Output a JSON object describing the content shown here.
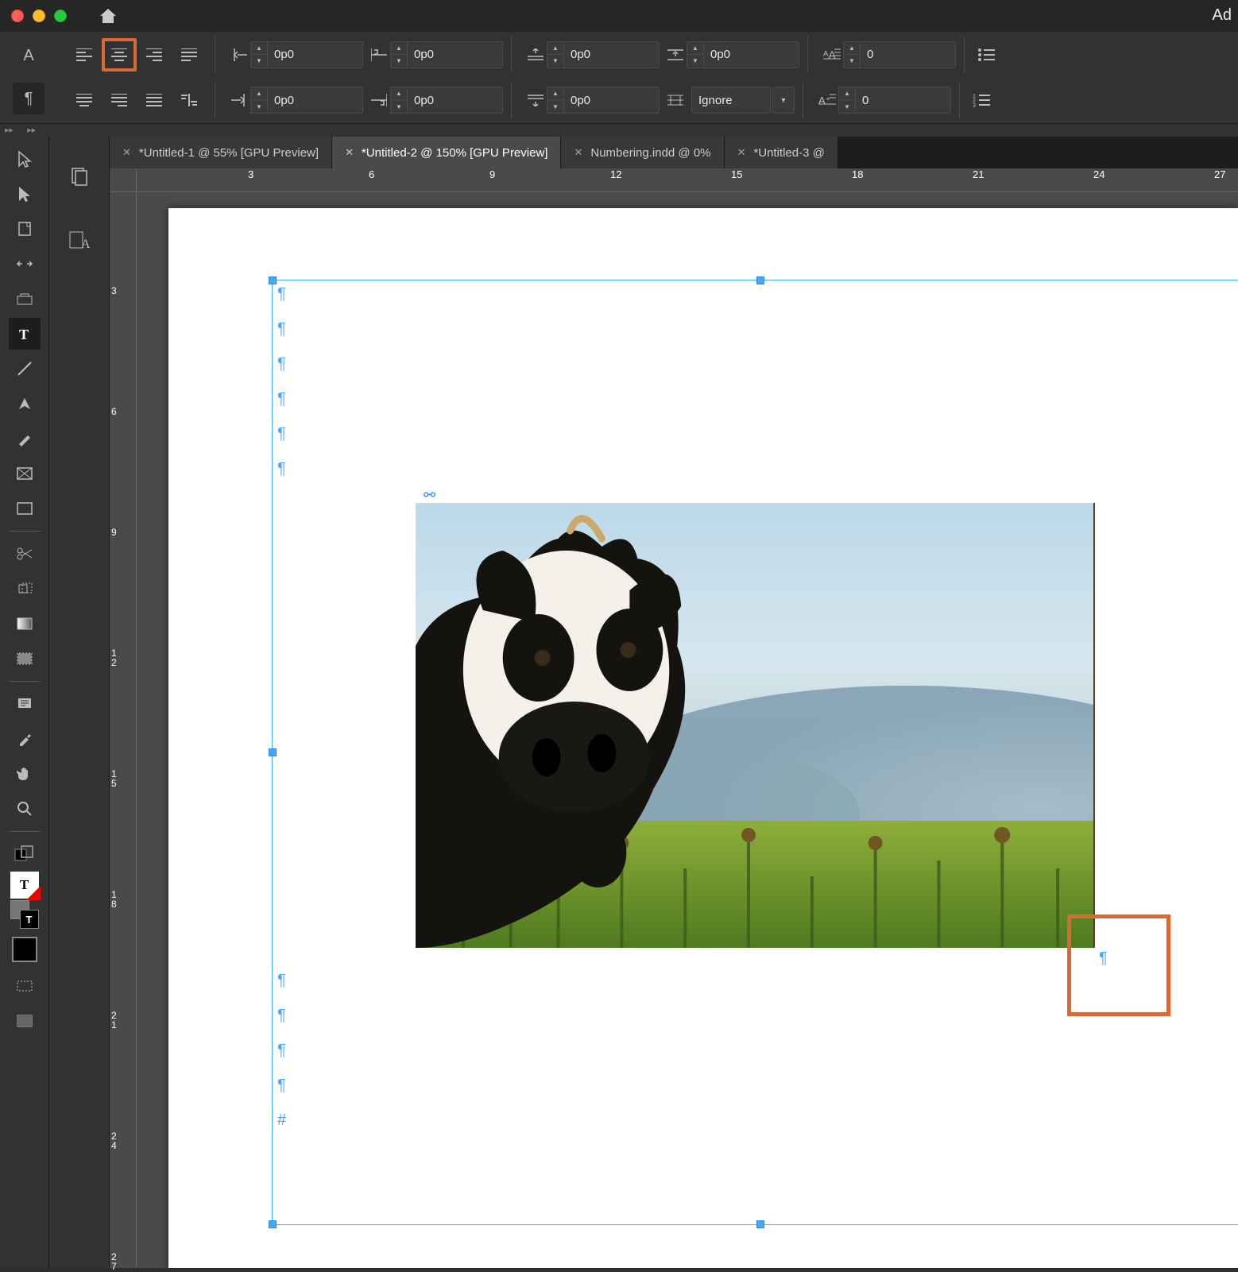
{
  "app_title_right": "Ad",
  "controlbar": {
    "left_indent": "0p0",
    "right_indent": "0p0",
    "first_line": "0p0",
    "last_line": "0p0",
    "space_before": "0p0",
    "space_after": "0p0",
    "baseline_grid": "Ignore",
    "drop_cap_lines": "0",
    "drop_cap_chars": "0"
  },
  "tabs": [
    {
      "label": "*Untitled-1 @ 55% [GPU Preview]",
      "active": false
    },
    {
      "label": "*Untitled-2 @ 150% [GPU Preview]",
      "active": true
    },
    {
      "label": "Numbering.indd @ 0%",
      "active": false
    },
    {
      "label": "*Untitled-3 @",
      "active": false
    }
  ],
  "ruler_h": [
    "3",
    "6",
    "9",
    "12",
    "15",
    "18",
    "21",
    "24",
    "27"
  ],
  "ruler_v": [
    "3",
    "6",
    "9",
    "12",
    "15",
    "18",
    "21",
    "27"
  ],
  "ruler_v_double": [
    "12",
    "15",
    "18",
    "21",
    "27"
  ]
}
